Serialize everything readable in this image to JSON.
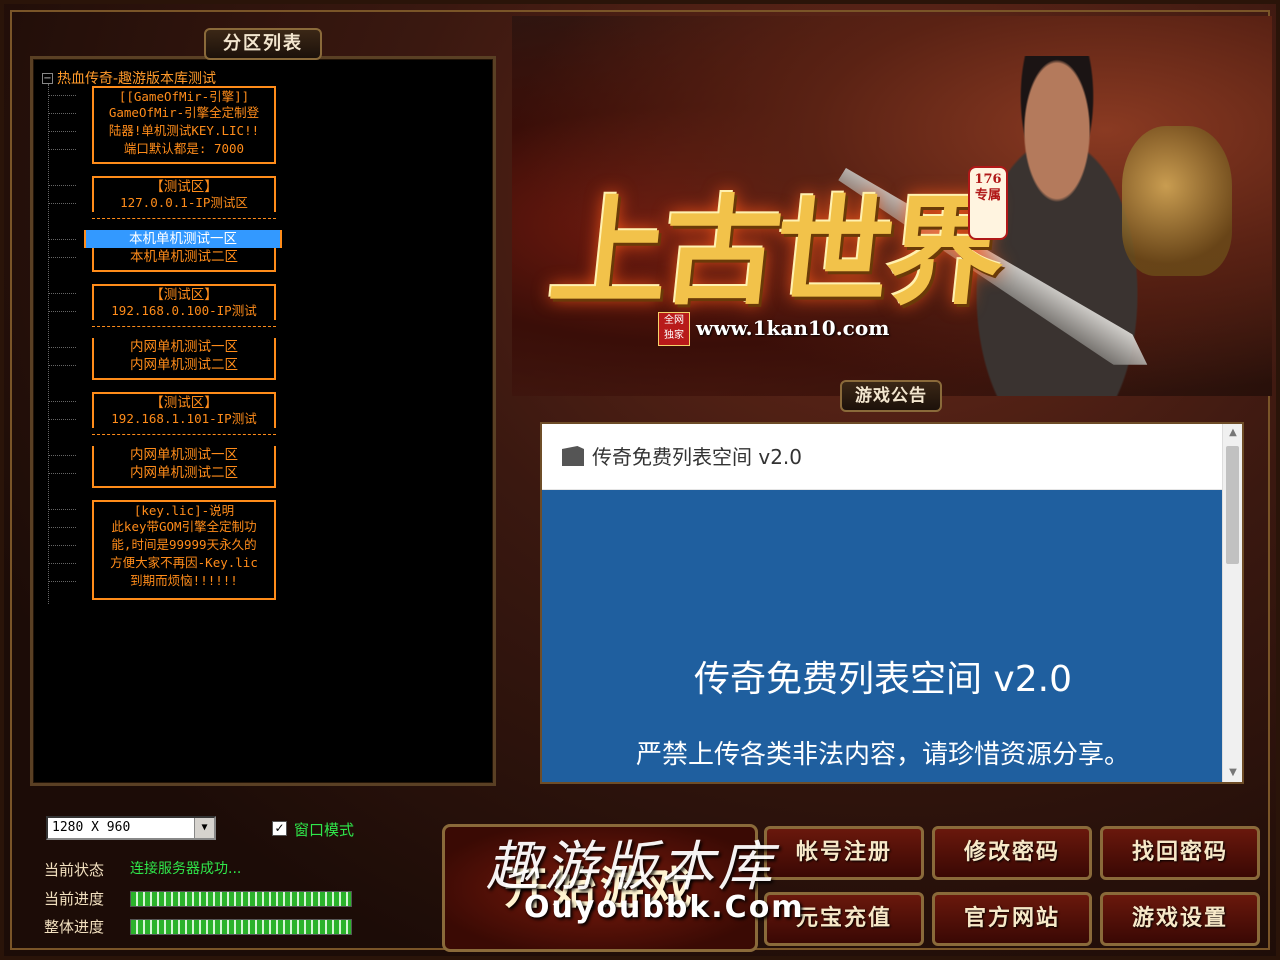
{
  "window": {
    "minimize_label": "—",
    "close_label": "✕"
  },
  "server_list": {
    "title": "分区列表",
    "root_label": "热血传奇-趣游版本库测试",
    "groups": [
      {
        "lines": [
          "[[GameOfMir-引擎]]",
          "GameOfMir-引擎全定制登",
          "陆器!单机测试KEY.LIC!!",
          "端口默认都是: 7000"
        ]
      },
      {
        "header": "【测试区】",
        "ip": "127.0.0.1-IP测试区",
        "servers": [
          "本机单机测试一区",
          "本机单机测试二区"
        ]
      },
      {
        "header": "【测试区】",
        "ip": "192.168.0.100-IP测试",
        "servers": [
          "内网单机测试一区",
          "内网单机测试二区"
        ]
      },
      {
        "header": "【测试区】",
        "ip": "192.168.1.101-IP测试",
        "servers": [
          "内网单机测试一区",
          "内网单机测试二区"
        ]
      },
      {
        "lines": [
          "[key.lic]-说明",
          "此key带GOM引擎全定制功",
          "能,时间是99999天永久的",
          "方便大家不再因-Key.lic",
          "到期而烦恼!!!!!!"
        ]
      }
    ],
    "selected": "本机单机测试一区"
  },
  "settings": {
    "resolution": "1280 X 960",
    "window_mode_label": "窗口模式",
    "window_mode_checked": true
  },
  "status": {
    "current_status_label": "当前状态",
    "current_status_value": "连接服务器成功...",
    "current_progress_label": "当前进度",
    "current_progress": 1.0,
    "overall_progress_label": "整体进度",
    "overall_progress": 1.0
  },
  "banner": {
    "title": "上古世界",
    "badge": "176 专属",
    "small_badge": "全网 独家",
    "url": "www.1kan10.com"
  },
  "notice": {
    "tab_label": "游戏公告",
    "header": "传奇免费列表空间 v2.0",
    "body_title": "传奇免费列表空间 v2.0",
    "body_text": "严禁上传各类非法内容，请珍惜资源分享。"
  },
  "buttons": {
    "start": "开始游戏",
    "register": "帐号注册",
    "change_password": "修改密码",
    "recover_password": "找回密码",
    "recharge": "元宝充值",
    "official_site": "官方网站",
    "game_settings": "游戏设置"
  },
  "watermark": {
    "text": "趣游版本库",
    "sub": "Ouyoubbk.Com"
  },
  "colors": {
    "tree_text": "#ff8c1a",
    "status_green": "#2fe64a",
    "notice_blue": "#1f5f9f",
    "selection": "#3399ff"
  }
}
